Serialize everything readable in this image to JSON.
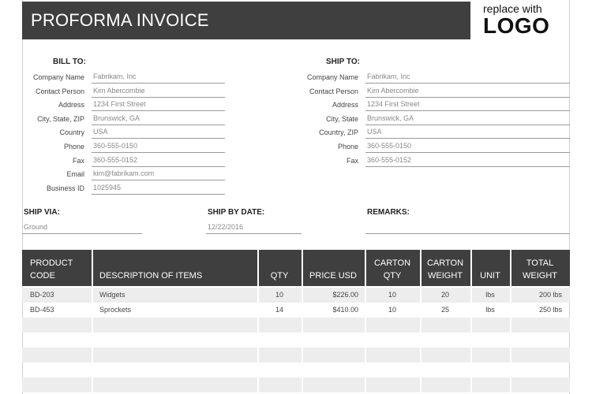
{
  "header": {
    "title": "PROFORMA INVOICE",
    "logo_line1": "replace with",
    "logo_line2": "LOGO"
  },
  "bill_to": {
    "heading": "BILL TO:",
    "fields": [
      {
        "label": "Company Name",
        "value": "Fabrikam, Inc"
      },
      {
        "label": "Contact Person",
        "value": "Kim Abercombie"
      },
      {
        "label": "Address",
        "value": "1234 First Street"
      },
      {
        "label": "City, State, ZIP",
        "value": "Brunswick, GA"
      },
      {
        "label": "Country",
        "value": "USA"
      },
      {
        "label": "Phone",
        "value": "360-555-0150"
      },
      {
        "label": "Fax",
        "value": "360-555-0152"
      },
      {
        "label": "Email",
        "value": "kim@fabrikam.com"
      },
      {
        "label": "Business ID",
        "value": "1025945"
      }
    ]
  },
  "ship_to": {
    "heading": "SHIP TO:",
    "fields": [
      {
        "label": "Company Name",
        "value": "Fabrikam, Inc"
      },
      {
        "label": "Contact Person",
        "value": "Kim Abercombie"
      },
      {
        "label": "Address",
        "value": "1234 First Street"
      },
      {
        "label": "City, State",
        "value": "Brunswick, GA"
      },
      {
        "label": "Country, ZIP",
        "value": "USA"
      },
      {
        "label": "Phone",
        "value": "360-555-0150"
      },
      {
        "label": "Fax",
        "value": "360-555-0152"
      }
    ]
  },
  "shipping": {
    "ship_via_label": "SHIP VIA:",
    "ship_via_value": "Ground",
    "ship_by_label": "SHIP BY DATE:",
    "ship_by_value": "12/22/2016",
    "remarks_label": "REMARKS:",
    "remarks_value": ""
  },
  "table": {
    "headers": {
      "product_code": "PRODUCT CODE",
      "description": "DESCRIPTION OF ITEMS",
      "qty": "QTY",
      "price": "PRICE USD",
      "carton_qty": "CARTON QTY",
      "carton_weight": "CARTON WEIGHT",
      "unit": "UNIT",
      "total_weight": "TOTAL WEIGHT"
    },
    "rows": [
      {
        "product_code": "BD-203",
        "description": "Widgets",
        "qty": "10",
        "price": "$226.00",
        "carton_qty": "10",
        "carton_weight": "20",
        "unit": "lbs",
        "total_weight": "200 lbs"
      },
      {
        "product_code": "BD-453",
        "description": "Sprockets",
        "qty": "14",
        "price": "$410.00",
        "carton_qty": "10",
        "carton_weight": "25",
        "unit": "lbs",
        "total_weight": "250 lbs"
      }
    ]
  }
}
